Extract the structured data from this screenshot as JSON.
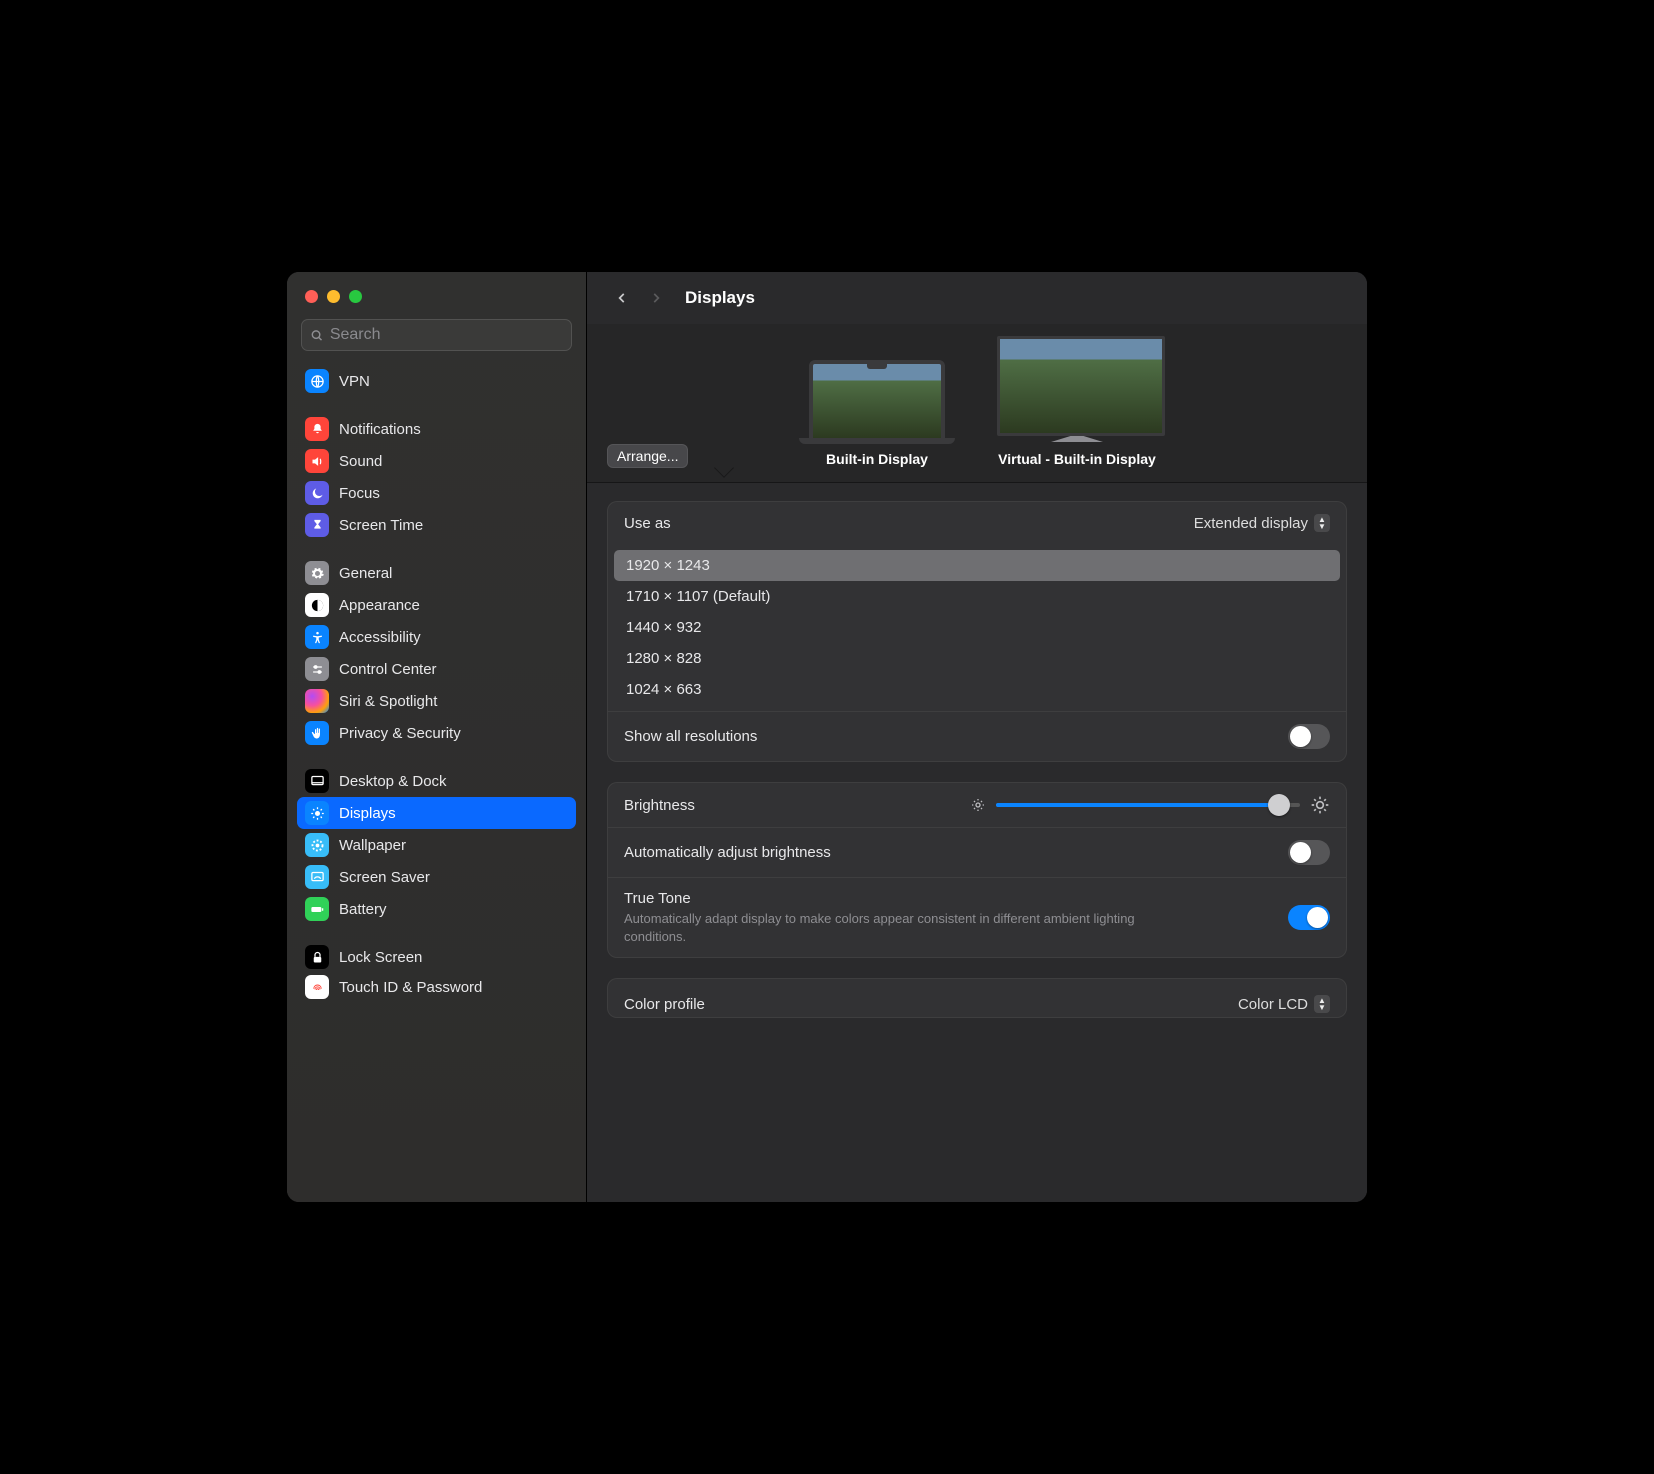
{
  "title": "Displays",
  "search_placeholder": "Search",
  "arrange_label": "Arrange...",
  "displays": {
    "builtin_label": "Built-in Display",
    "virtual_label": "Virtual - Built-in Display"
  },
  "use_as": {
    "label": "Use as",
    "value": "Extended display"
  },
  "resolutions": [
    "1920 × 1243",
    "1710 × 1107 (Default)",
    "1440 × 932",
    "1280 × 828",
    "1024 × 663"
  ],
  "selected_resolution_index": 0,
  "show_all_res_label": "Show all resolutions",
  "brightness_label": "Brightness",
  "auto_brightness_label": "Automatically adjust brightness",
  "true_tone": {
    "label": "True Tone",
    "subtext": "Automatically adapt display to make colors appear consistent in different ambient lighting conditions."
  },
  "color_profile": {
    "label": "Color profile",
    "value": "Color LCD"
  },
  "sidebar": {
    "vpn": "VPN",
    "notifications": "Notifications",
    "sound": "Sound",
    "focus": "Focus",
    "screen_time": "Screen Time",
    "general": "General",
    "appearance": "Appearance",
    "accessibility": "Accessibility",
    "control_center": "Control Center",
    "siri": "Siri & Spotlight",
    "privacy": "Privacy & Security",
    "desktop": "Desktop & Dock",
    "displays": "Displays",
    "wallpaper": "Wallpaper",
    "screen_saver": "Screen Saver",
    "battery": "Battery",
    "lock_screen": "Lock Screen",
    "touch_id": "Touch ID & Password"
  }
}
